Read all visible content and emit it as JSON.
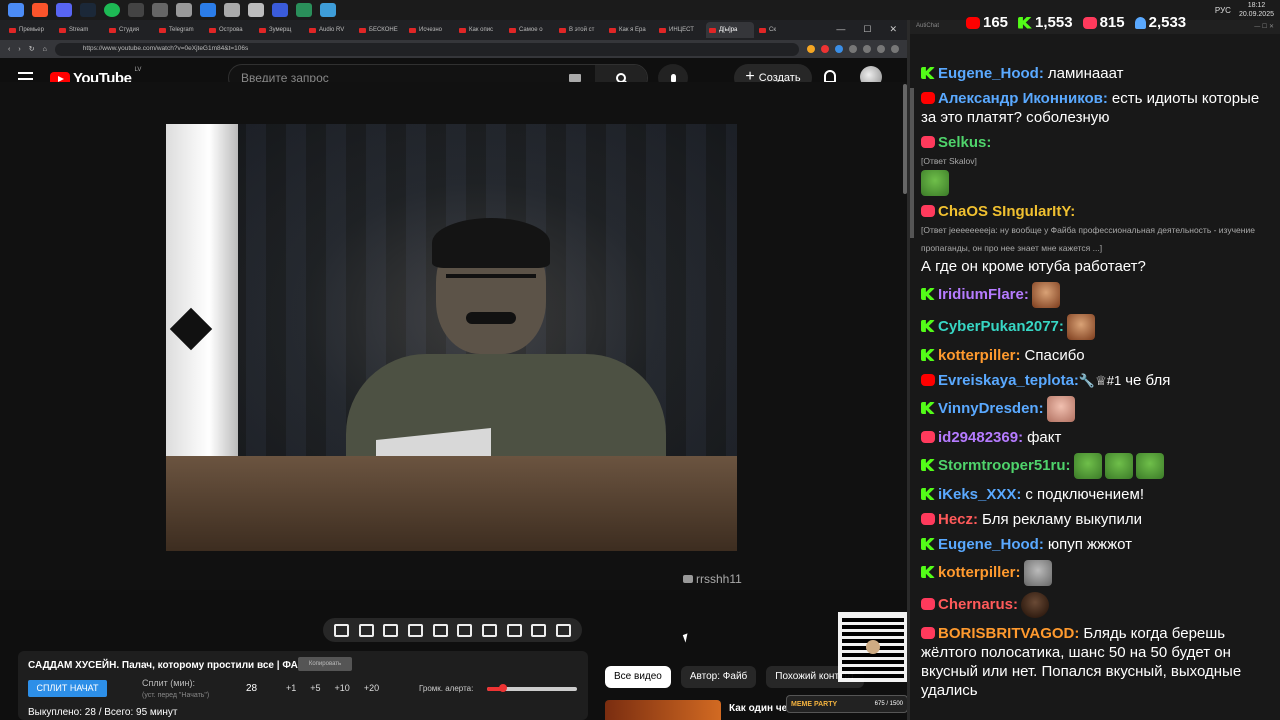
{
  "browser": {
    "tabs": [
      "Премьер",
      "Stream",
      "Студия",
      "Telegram",
      "Острова",
      "Зумерщ",
      "Audio RV",
      "БЕСКОНЕ",
      "Исчезно",
      "Как опис",
      "Самое о",
      "В этой ст",
      "Как я Ера",
      "ИНЦЕСТ",
      "Д[ы]ра",
      "Ск"
    ],
    "url": "https://www.youtube.com/watch?v=0eXjteG1m84&t=106s",
    "tray_lang": "РУС",
    "tray_time": "18:12",
    "tray_date": "20.09.2025"
  },
  "stats": {
    "youtube_viewers": "165",
    "kick_viewers": "1,553",
    "vk_viewers": "815",
    "total_viewers": "2,533"
  },
  "youtube": {
    "logo": "YouTube",
    "country": "LV",
    "search_placeholder": "Введите запрос",
    "create_label": "Создать",
    "watermark": "rrsshh11",
    "video_title": "САДДАМ ХУСЕЙН. Палач, которому простили все | ФАЙБ",
    "copy_label": "Копировать",
    "split_button": "СПЛИТ НАЧАТ",
    "split_label": "Сплит (мин):",
    "split_sub": "(уст. перед \"Начать\")",
    "split_value": "28",
    "increments": [
      "+1",
      "+5",
      "+10",
      "+20"
    ],
    "alert_volume_label": "Громк. алерта:",
    "alert_volume": 0.18,
    "bought": "Выкуплено: 28 / Всего: 95 минут",
    "chips": [
      "Все видео",
      "Автор: Файб",
      "Похожий контент"
    ],
    "next_title": "Как один чел",
    "meme_party": "MEME PARTY",
    "meme_count": "675 / 1500"
  },
  "chat": {
    "app_title": "AutiChat",
    "messages": [
      {
        "platform": "kick",
        "nick": "Eugene_Hood:",
        "color": "#5aa9ff",
        "text": "ламинааат"
      },
      {
        "platform": "yt",
        "nick": "Александр Иконников:",
        "color": "#5aa9ff",
        "text": "есть идиоты которые за это платят? соболезную"
      },
      {
        "platform": "vk",
        "nick": "Selkus:",
        "color": "#4fd36b",
        "reply": "[Ответ Skalov]",
        "text": ""
      },
      {
        "platform": "vk",
        "nick": "ChaOS SIngularItY:",
        "color": "#f0c030",
        "reply": "[Ответ jeeeeeeeeja: ну вообще у Файба профессиональная деятельность - изучение пропаганды, он про нее знает мне кажется ...]",
        "text": "А где он кроме ютуба работает?"
      },
      {
        "platform": "kick",
        "nick": "IridiumFlare:",
        "color": "#b57bff",
        "text": ""
      },
      {
        "platform": "kick",
        "nick": "CyberPukan2077:",
        "color": "#37d6c4",
        "text": ""
      },
      {
        "platform": "kick",
        "nick": "kotterpiller:",
        "color": "#ff9a2e",
        "text": "Спасибо"
      },
      {
        "platform": "yt",
        "nick": "Evreiskaya_teplota:",
        "color": "#5aa9ff",
        "text": "че бля"
      },
      {
        "platform": "kick",
        "nick": "VinnyDresden:",
        "color": "#5aa9ff",
        "text": ""
      },
      {
        "platform": "vk",
        "nick": "id29482369:",
        "color": "#b57bff",
        "text": "факт"
      },
      {
        "platform": "kick",
        "nick": "Stormtrooper51ru:",
        "color": "#4fd36b",
        "text": ""
      },
      {
        "platform": "kick",
        "nick": "iKeks_XXX:",
        "color": "#5aa9ff",
        "text": "с подключением!"
      },
      {
        "platform": "vk",
        "nick": "Hecz:",
        "color": "#ff5a5a",
        "text": "Бля рекламу выкупили"
      },
      {
        "platform": "kick",
        "nick": "Eugene_Hood:",
        "color": "#5aa9ff",
        "text": "юпуп жжжот"
      },
      {
        "platform": "kick",
        "nick": "kotterpiller:",
        "color": "#ff9a2e",
        "text": ""
      },
      {
        "platform": "vk",
        "nick": "Chernarus:",
        "color": "#ff5a5a",
        "text": ""
      },
      {
        "platform": "vk",
        "nick": "BORISBRITVAGOD:",
        "color": "#ff9a2e",
        "text": "Блядь когда берешь жёлтого полосатика, шанс 50 на 50 будет он вкусный или нет. Попался вкусный, выходные удались"
      }
    ]
  },
  "colors": {
    "kick": "#53fc18",
    "youtube": "#ff0000",
    "vk": "#ff3a5c",
    "accent_blue": "#2d8fe8"
  }
}
